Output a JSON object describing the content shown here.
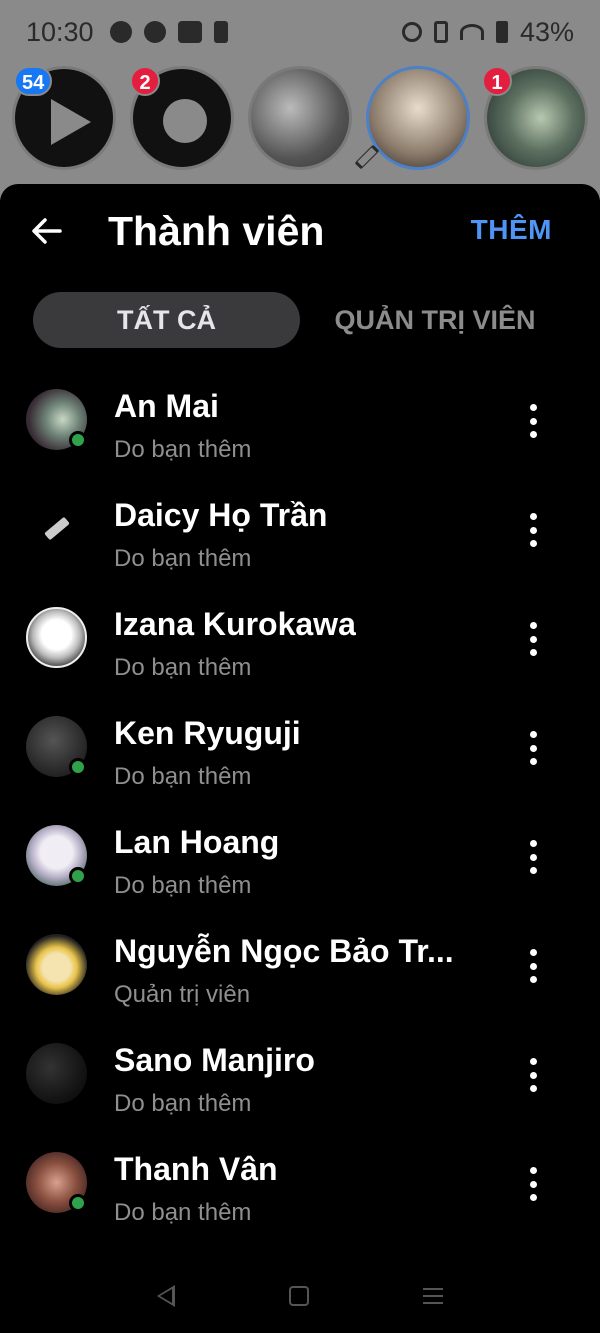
{
  "status_bar": {
    "time": "10:30",
    "battery": "43%"
  },
  "stories": {
    "badges": [
      "54",
      "2",
      "1"
    ]
  },
  "header": {
    "title": "Thành viên",
    "add_label": "THÊM"
  },
  "tabs": [
    {
      "label": "TẤT CẢ",
      "active": true
    },
    {
      "label": "QUẢN TRỊ VIÊN",
      "active": false
    }
  ],
  "members": [
    {
      "name": "An Mai",
      "subtitle": "Do bạn thêm",
      "online": true
    },
    {
      "name": "Daicy Họ Trần",
      "subtitle": "Do bạn thêm",
      "online": false
    },
    {
      "name": "Izana Kurokawa",
      "subtitle": "Do bạn thêm",
      "online": false
    },
    {
      "name": "Ken Ryuguji",
      "subtitle": "Do bạn thêm",
      "online": true
    },
    {
      "name": "Lan Hoang",
      "subtitle": "Do bạn thêm",
      "online": true
    },
    {
      "name": "Nguyễn Ngọc Bảo Tr...",
      "subtitle": "Quản trị viên",
      "online": false
    },
    {
      "name": "Sano Manjiro",
      "subtitle": "Do bạn thêm",
      "online": false
    },
    {
      "name": "Thanh Vân",
      "subtitle": "Do bạn thêm",
      "online": true
    }
  ],
  "colors": {
    "accent": "#4f95f5",
    "online": "#31a24c",
    "badge_blue": "#1877f2",
    "badge_red": "#e41e3f"
  }
}
